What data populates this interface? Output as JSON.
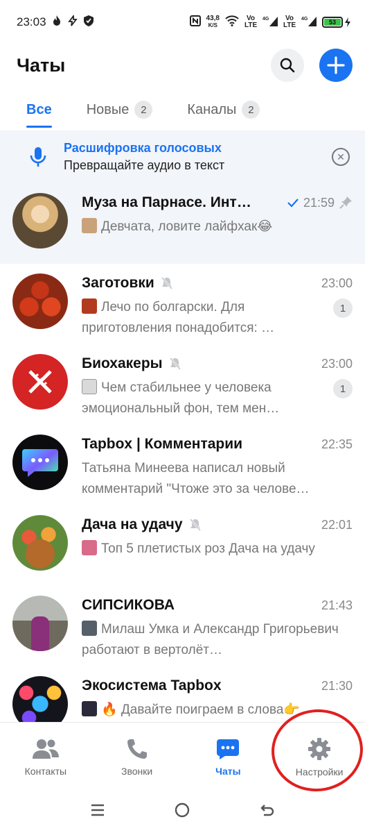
{
  "status_bar": {
    "time": "23:03",
    "speed_value": "43,8",
    "speed_unit": "K/S",
    "sim1": "Vo LTE",
    "sim1_net": "4G",
    "sim2": "Vo LTE",
    "sim2_net": "4G",
    "battery": "53"
  },
  "header": {
    "title": "Чаты"
  },
  "tabs": [
    {
      "label": "Все",
      "badge": ""
    },
    {
      "label": "Новые",
      "badge": "2"
    },
    {
      "label": "Каналы",
      "badge": "2"
    }
  ],
  "banner": {
    "title": "Расшифровка голосовых",
    "subtitle": "Превращайте аудио в текст"
  },
  "chats": [
    {
      "name": "Муза на Парнасе. Инт…",
      "time": "21:59",
      "preview": "Девчата, ловите лайфхак😂",
      "unread": "",
      "muted": false,
      "pinned": true,
      "read": true
    },
    {
      "name": "Заготовки",
      "time": "23:00",
      "preview": "Лечо по болгарски. Для приготовления понадобится: …",
      "unread": "1",
      "muted": true
    },
    {
      "name": "Биохакеры",
      "time": "23:00",
      "preview": "Чем стабильнее у человека эмоциональный фон, тем мен…",
      "unread": "1",
      "muted": true
    },
    {
      "name": "Tapbox | Комментарии",
      "time": "22:35",
      "preview": "Татьяна Минеева написал новый комментарий \"Чтоже это за челове…",
      "unread": "",
      "muted": false
    },
    {
      "name": "Дача на удачу",
      "time": "22:01",
      "preview": "Топ 5 плетистых роз Дача на удачу",
      "unread": "",
      "muted": true
    },
    {
      "name": "СИПСИКОВА",
      "time": "21:43",
      "preview": "Милаш Умка и Александр Григорьевич работают в вертолёт…",
      "unread": "",
      "muted": false
    },
    {
      "name": "Экосистема Tapbox",
      "time": "21:30",
      "preview": "🔥 Давайте поиграем в слова👉",
      "unread": "",
      "muted": false
    }
  ],
  "bottom_nav": [
    {
      "label": "Контакты",
      "icon": "contacts-icon"
    },
    {
      "label": "Звонки",
      "icon": "phone-icon"
    },
    {
      "label": "Чаты",
      "icon": "chat-icon",
      "active": true
    },
    {
      "label": "Настройки",
      "icon": "gear-icon"
    }
  ],
  "colors": {
    "accent": "#1a73f1",
    "annotation": "#e0201f"
  }
}
